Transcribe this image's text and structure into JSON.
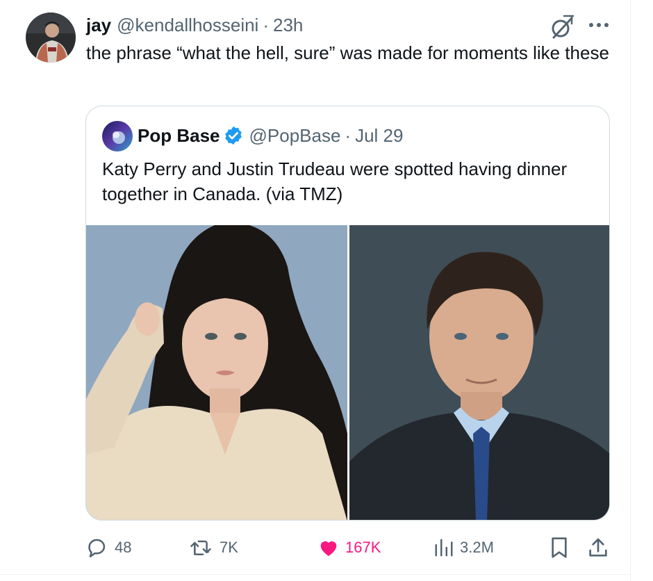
{
  "tweet": {
    "author_name": "jay",
    "author_handle": "@kendallhosseini",
    "separator": "·",
    "time": "23h",
    "text": "the phrase “what the hell, sure” was made for moments like these",
    "icons": {
      "grok": "grok-icon",
      "more": "more-icon",
      "avatar": "avatar"
    }
  },
  "quote": {
    "author_name": "Pop Base",
    "verified": true,
    "author_handle": "@PopBase",
    "separator": "·",
    "date": "Jul 29",
    "text": "Katy Perry and Justin Trudeau were spotted having dinner together in Canada. (via TMZ)",
    "media": [
      "woman-portrait-photo",
      "man-portrait-photo"
    ]
  },
  "actions": {
    "replies": "48",
    "reposts": "7K",
    "likes": "167K",
    "views": "3.2M",
    "liked": true
  },
  "colors": {
    "text": "#0f1419",
    "secondary": "#536471",
    "border": "#cfd9de",
    "like": "#f91880",
    "verified": "#1d9bf0"
  }
}
